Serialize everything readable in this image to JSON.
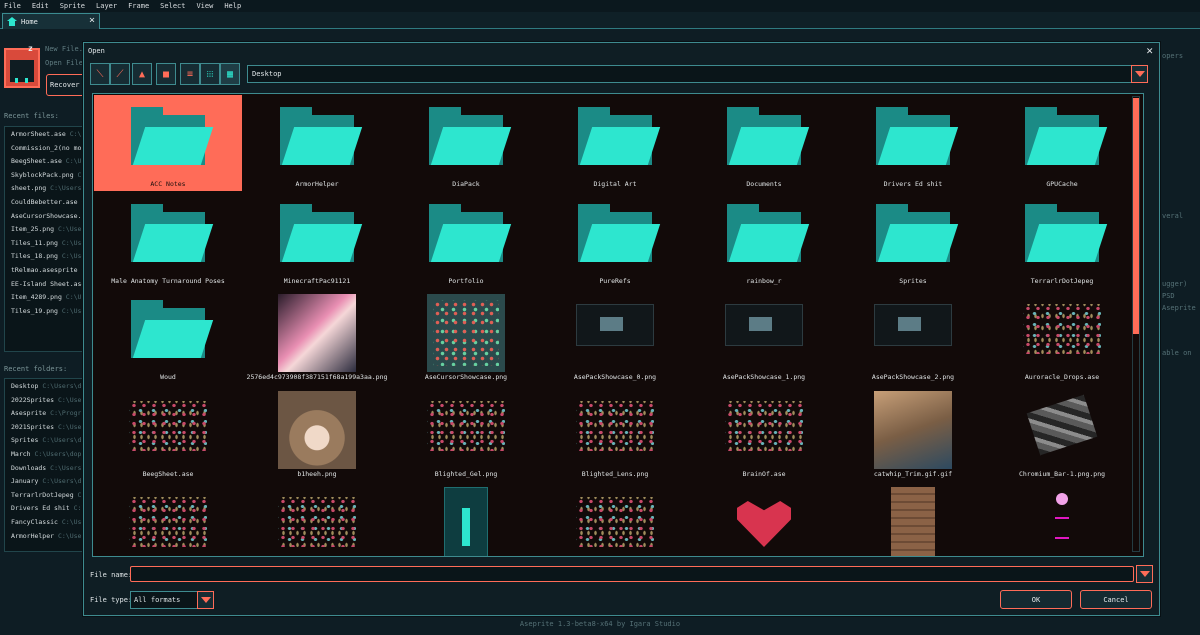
{
  "menu": [
    "File",
    "Edit",
    "Sprite",
    "Layer",
    "Frame",
    "Select",
    "View",
    "Help"
  ],
  "tab": {
    "label": "Home"
  },
  "home": {
    "new_file": "New File...",
    "open_file": "Open File...",
    "recover": "Recover F",
    "recent_files_title": "Recent files:",
    "recent_folders_title": "Recent folders:",
    "recent_files": [
      {
        "name": "ArmorSheet.ase",
        "path": "C:\\Use"
      },
      {
        "name": "Commission_2(no more",
        "path": ""
      },
      {
        "name": "BeegSheet.ase",
        "path": "C:\\Use"
      },
      {
        "name": "SkyblockPack.png",
        "path": "C:\\Use"
      },
      {
        "name": "sheet.png",
        "path": "C:\\Users\\d"
      },
      {
        "name": "CouldBebetter.ase",
        "path": "C:\\Us"
      },
      {
        "name": "AseCursorShowcase.png",
        "path": ""
      },
      {
        "name": "Item_25.png",
        "path": "C:\\Users\\"
      },
      {
        "name": "Tiles_11.png",
        "path": "C:\\Users\\"
      },
      {
        "name": "Tiles_18.png",
        "path": "C:\\Users\\"
      },
      {
        "name": "tRelmao.asesprite",
        "path": "C:\\Us"
      },
      {
        "name": "EE-Island Sheet.ase",
        "path": ""
      },
      {
        "name": "Item_4289.png",
        "path": "C:\\Use"
      },
      {
        "name": "Tiles_19.png",
        "path": "C:\\Users\\"
      }
    ],
    "recent_folders": [
      {
        "name": "Desktop",
        "path": "C:\\Users\\dopl"
      },
      {
        "name": "2022Sprites",
        "path": "C:\\Users\\"
      },
      {
        "name": "Asesprite",
        "path": "C:\\Program F"
      },
      {
        "name": "2021Sprites",
        "path": "C:\\Users\\"
      },
      {
        "name": "Sprites",
        "path": "C:\\Users\\doph"
      },
      {
        "name": "March",
        "path": "C:\\Users\\doph"
      },
      {
        "name": "Downloads",
        "path": "C:\\Users\\do"
      },
      {
        "name": "January",
        "path": "C:\\Users\\do"
      },
      {
        "name": "TerrarlrDotJepeg",
        "path": "C:\\Use"
      },
      {
        "name": "Drivers Ed shit",
        "path": "C:\\Use"
      },
      {
        "name": "FancyClassic",
        "path": "C:\\Users"
      },
      {
        "name": "ArmorHelper",
        "path": "C:\\Users\\"
      }
    ],
    "right_fragments": [
      "opers",
      "veral",
      "ugger)",
      "PSD",
      "Aseprite",
      "able on"
    ]
  },
  "status": "Aseprite 1.3-beta8-x64 by Igara Studio",
  "dialog": {
    "title": "Open",
    "location": "Desktop",
    "file_name_label": "File name:",
    "file_name_value": "",
    "file_type_label": "File type:",
    "file_type_value": "All formats",
    "ok_label": "OK",
    "cancel_label": "Cancel",
    "toolbar_icons": [
      "back-arrow-icon",
      "forward-arrow-icon",
      "up-folder-icon",
      "new-folder-icon",
      "list-view-icon",
      "small-icons-view-icon",
      "large-icons-view-icon"
    ],
    "files": [
      {
        "label": "ACC Notes",
        "kind": "folder",
        "selected": true
      },
      {
        "label": "ArmorHelper",
        "kind": "folder"
      },
      {
        "label": "DiaPack",
        "kind": "folder"
      },
      {
        "label": "Digital Art",
        "kind": "folder"
      },
      {
        "label": "Documents",
        "kind": "folder"
      },
      {
        "label": "Drivers Ed shit",
        "kind": "folder"
      },
      {
        "label": "GPUCache",
        "kind": "folder"
      },
      {
        "label": "Male Anatomy Turnaround Poses",
        "kind": "folder"
      },
      {
        "label": "MinecraftPac91121",
        "kind": "folder"
      },
      {
        "label": "Portfolio",
        "kind": "folder"
      },
      {
        "label": "PureRefs",
        "kind": "folder"
      },
      {
        "label": "rainbow_r",
        "kind": "folder"
      },
      {
        "label": "Sprites",
        "kind": "folder"
      },
      {
        "label": "TerrarlrDotJepeg",
        "kind": "folder"
      },
      {
        "label": "Woud",
        "kind": "folder"
      },
      {
        "label": "2576ed4c973908f387151f68a199a3aa.png",
        "kind": "anime"
      },
      {
        "label": "AseCursorShowcase.png",
        "kind": "sheet"
      },
      {
        "label": "AsePackShowcase_0.png",
        "kind": "screen"
      },
      {
        "label": "AsePackShowcase_1.png",
        "kind": "screen"
      },
      {
        "label": "AsePackShowcase_2.png",
        "kind": "screen"
      },
      {
        "label": "Auroracle_Drops.ase",
        "kind": "sprites"
      },
      {
        "label": "BeegSheet.ase",
        "kind": "sprites"
      },
      {
        "label": "b1heeh.png",
        "kind": "cat"
      },
      {
        "label": "Blighted_Gel.png",
        "kind": "sprites"
      },
      {
        "label": "Blighted_Lens.png",
        "kind": "sprites"
      },
      {
        "label": "BrainOf.ase",
        "kind": "sprites"
      },
      {
        "label": "catwhip_Trim.gif.gif",
        "kind": "photo"
      },
      {
        "label": "Chromium_Bar-1.png.png",
        "kind": "gray"
      },
      {
        "label": "",
        "kind": "sprites"
      },
      {
        "label": "",
        "kind": "sprites"
      },
      {
        "label": "",
        "kind": "bar"
      },
      {
        "label": "",
        "kind": "sprites"
      },
      {
        "label": "",
        "kind": "heart"
      },
      {
        "label": "",
        "kind": "door"
      },
      {
        "label": "",
        "kind": "magenta"
      }
    ]
  }
}
